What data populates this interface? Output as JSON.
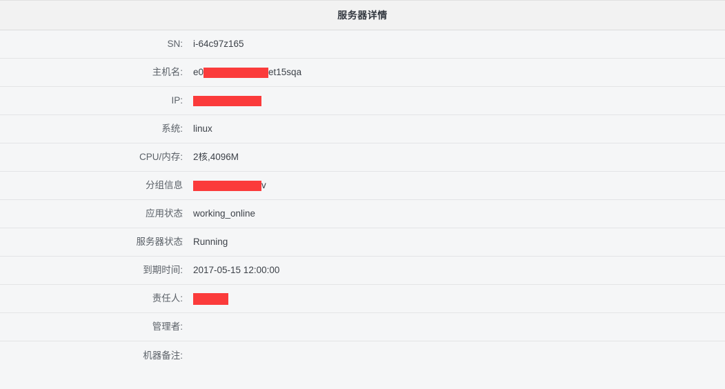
{
  "header": {
    "title": "服务器详情"
  },
  "rows": [
    {
      "label": "SN:",
      "value": "i-64c97z165",
      "redacted": false
    },
    {
      "label": "主机名:",
      "prefix": "e0",
      "suffix": "et15sqa",
      "redacted": true,
      "redaction_width": 94
    },
    {
      "label": "IP:",
      "prefix": "",
      "suffix": "",
      "redacted": true,
      "redaction_width": 99
    },
    {
      "label": "系统:",
      "value": "linux",
      "redacted": false
    },
    {
      "label": "CPU/内存:",
      "value": "2核,4096M",
      "redacted": false
    },
    {
      "label": "分组信息",
      "prefix": "",
      "suffix": "v",
      "redacted": true,
      "redaction_width": 99
    },
    {
      "label": "应用状态",
      "value": "working_online",
      "redacted": false
    },
    {
      "label": "服务器状态",
      "value": "Running",
      "redacted": false
    },
    {
      "label": "到期时间:",
      "value": "2017-05-15 12:00:00",
      "redacted": false
    },
    {
      "label": "责任人:",
      "prefix": "",
      "suffix": "",
      "redacted": true,
      "redaction_width": 51
    },
    {
      "label": "管理者:",
      "value": "",
      "redacted": false
    },
    {
      "label": "机器备注:",
      "value": "",
      "redacted": false
    }
  ],
  "colors": {
    "redaction": "#fb3b3b",
    "header_background": "#f2f2f2",
    "row_background": "#f5f6f7",
    "row_divider": "#e3e4e6",
    "label_text": "#5b6168",
    "value_text": "#3c4148",
    "title_text": "#333840"
  }
}
